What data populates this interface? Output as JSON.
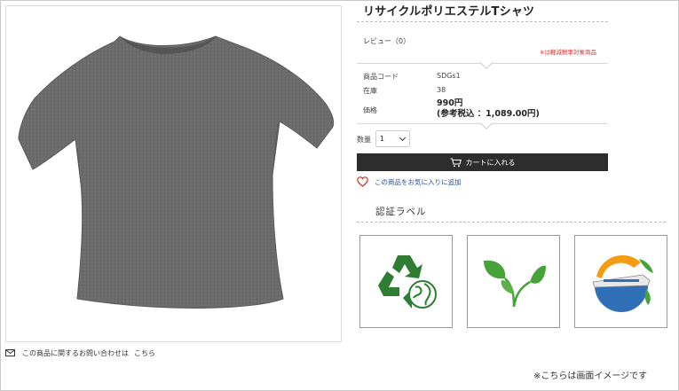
{
  "product": {
    "title": "リサイクルポリエステルTシャツ",
    "review_label": "レビュー（0）",
    "tax_note": "※は軽減税率対象商品",
    "specs": [
      {
        "label": "商品コード",
        "value": "SDGs1"
      },
      {
        "label": "在庫",
        "value": "38"
      }
    ],
    "price_label": "価格",
    "price": "990円",
    "price_tax_included": "(参考税込 ：1,089.00円)"
  },
  "purchase": {
    "qty_label": "数量",
    "qty_value": "1",
    "cart_button": "カートに入れる",
    "favorite_link": "この商品をお気に入りに追加"
  },
  "certification": {
    "title": "認証ラベル",
    "labels": [
      {
        "icon": "recycle-globe-icon"
      },
      {
        "icon": "leaves-icon"
      },
      {
        "icon": "eco-train-icon"
      }
    ]
  },
  "inquiry": {
    "text": "この商品に関するお問い合わせは",
    "link": "こちら"
  },
  "caption": "※こちらは画面イメージです",
  "colors": {
    "button_bg": "#2d2d2d",
    "tax_note": "#d9302c",
    "link": "#2a4f9e",
    "heart": "#c0392b",
    "recycle_green": "#2e7d32",
    "leaf_green": "#45a33a"
  }
}
